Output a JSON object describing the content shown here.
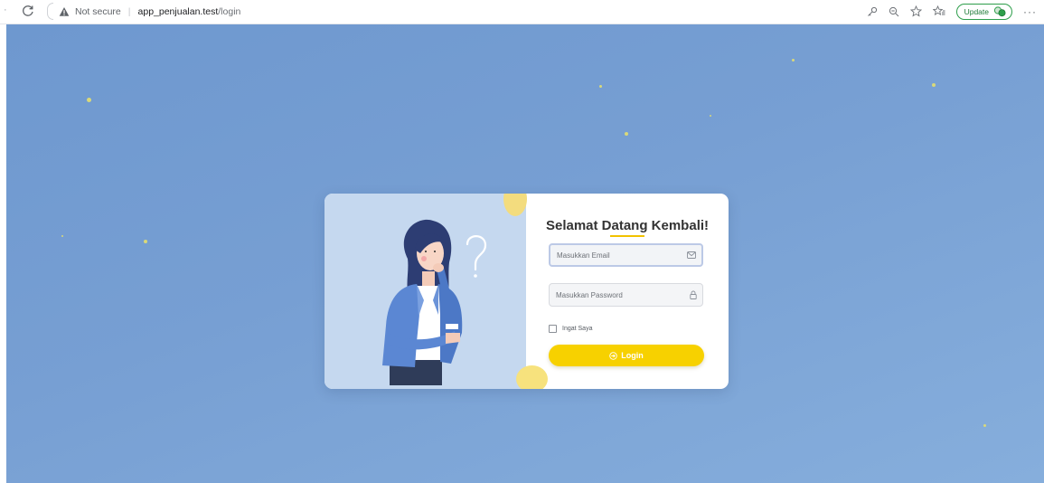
{
  "browser": {
    "address_warning": "Not secure",
    "address_host": "app_penjualan.test",
    "address_path": "/login",
    "update_label": "Update",
    "more_label": "···"
  },
  "login": {
    "title": "Selamat Datang Kembali!",
    "email_placeholder": "Masukkan Email",
    "password_placeholder": "Masukkan Password",
    "remember_label": "Ingat Saya",
    "button_label": "Login"
  },
  "colors": {
    "accent": "#f7d100",
    "background": "#779fd3",
    "illustration_panel": "#c5d8ef"
  },
  "icons": [
    "reload-icon",
    "warning-icon",
    "key-icon",
    "zoom-icon",
    "star-icon",
    "favorites-icon",
    "profile-icon",
    "envelope-icon",
    "lock-icon",
    "login-icon",
    "question-mark-icon"
  ]
}
